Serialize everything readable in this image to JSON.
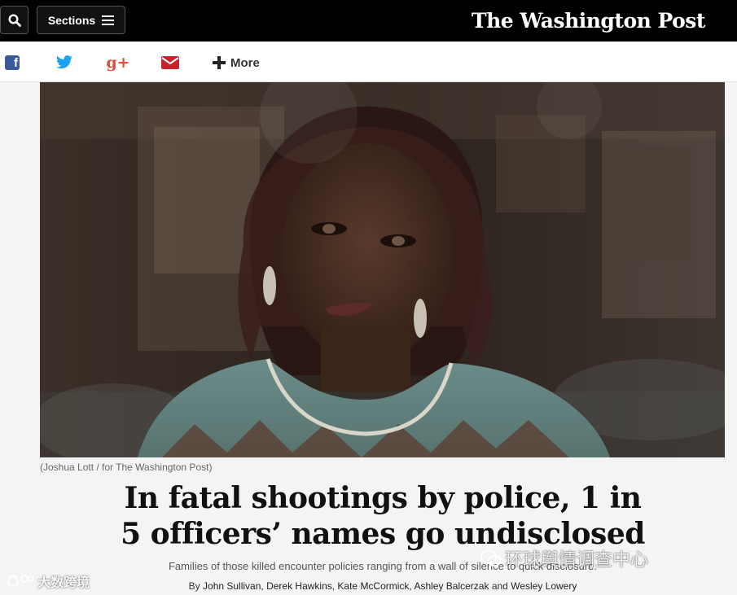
{
  "header": {
    "search_icon": "search-icon",
    "sections_label": "Sections",
    "menu_icon": "hamburger-icon",
    "logo_text": "The Washington Post"
  },
  "share": {
    "facebook_icon": "facebook-icon",
    "twitter_icon": "twitter-icon",
    "googleplus_text": "g+",
    "email_icon": "email-icon",
    "more_label": "More"
  },
  "article": {
    "photo_credit": "(Joshua Lott / for The Washington Post)",
    "headline_line1": "In fatal shootings by police, 1 in",
    "headline_line2": "5 officers’ names go undisclosed",
    "dek": "Families of those killed encounter policies ranging from a wall of silence to quick disclosure.",
    "byline_prefix": "By",
    "authors": "John Sullivan, Derek Hawkins, Kate McCormick, Ashley Balcerzak",
    "byline_and": "and",
    "last_author": "Wesley Lowery"
  },
  "watermarks": {
    "right_text": "环球舆情调查中心",
    "left_text": "大数跨境"
  },
  "colors": {
    "topbar": "#000000",
    "facebook": "#3b5998",
    "twitter": "#1da1f2",
    "googleplus": "#dd4b39",
    "email": "#c8232c"
  }
}
